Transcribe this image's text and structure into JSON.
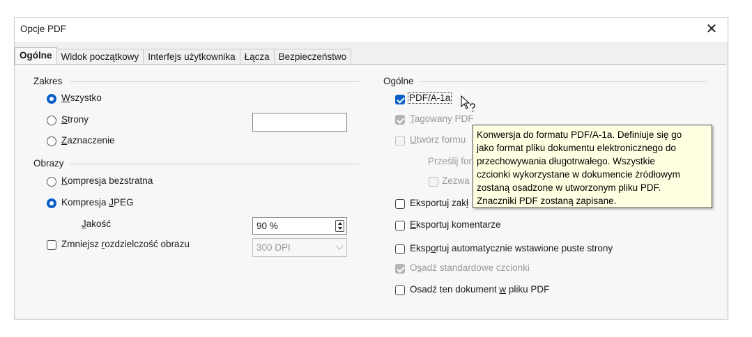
{
  "window": {
    "title": "Opcje PDF"
  },
  "tabs": [
    {
      "label": "Ogólne",
      "active": true
    },
    {
      "label": "Widok początkowy",
      "active": false
    },
    {
      "label": "Interfejs użytkownika",
      "active": false
    },
    {
      "label": "Łącza",
      "active": false
    },
    {
      "label": "Bezpieczeństwo",
      "active": false
    }
  ],
  "range": {
    "heading": "Zakres",
    "all": {
      "pre": "",
      "u": "W",
      "post": "szystko",
      "selected": true
    },
    "pages": {
      "pre": "",
      "u": "S",
      "post": "trony",
      "selected": false
    },
    "pages_value": "",
    "selection": {
      "pre": "",
      "u": "Z",
      "post": "aznaczenie",
      "selected": false
    }
  },
  "images": {
    "heading": "Obrazy",
    "lossless": {
      "pre": "",
      "u": "K",
      "post": "ompresja bezstratna",
      "selected": false
    },
    "jpeg": {
      "pre": "Kompresja ",
      "u": "J",
      "post": "PEG",
      "selected": true
    },
    "quality": {
      "pre": "",
      "u": "J",
      "post": "akość",
      "value": "90 %"
    },
    "reduce": {
      "pre": "Zmniejsz ",
      "u": "r",
      "post": "ozdzielczość obrazu",
      "checked": false,
      "value": "300 DPI"
    }
  },
  "general": {
    "heading": "Ogólne",
    "pdfa": {
      "label": "PDF/A-1a",
      "checked": true
    },
    "tagged": {
      "pre": "",
      "u": "T",
      "post": "agowany PDF",
      "checked": true,
      "disabled": true
    },
    "form": {
      "pre": "",
      "u": "U",
      "post": "twórz formu",
      "checked": false,
      "disabled": true
    },
    "submit": {
      "label": "Prześlij for"
    },
    "allow": {
      "label": "Zezwa",
      "checked": false
    },
    "bookmarks": {
      "pre": "Eksportuj zak",
      "u": "ł",
      "post": "",
      "checked": false
    },
    "comments": {
      "pre": "",
      "u": "E",
      "post": "ksportuj komentarze",
      "checked": false
    },
    "blank": {
      "pre": "Eksp",
      "u": "o",
      "post": "rtuj automatycznie wstawione puste strony",
      "checked": false
    },
    "fonts": {
      "pre": "O",
      "u": "s",
      "post": "adź standardowe czcionki",
      "checked": true,
      "disabled": true
    },
    "embed": {
      "pre": "Osadź ten dokument ",
      "u": "w",
      "post": " pliku PDF",
      "checked": false
    }
  },
  "tooltip": {
    "lines": [
      "Konwersja do formatu PDF/A-1a. Definiuje się go",
      "jako format pliku dokumentu elektronicznego do",
      "przechowywania długotrwałego. Wszystkie",
      "czcionki wykorzystane w dokumencie źródłowym",
      "zostaną osadzone w utworzonym pliku PDF.",
      "Znaczniki PDF zostaną zapisane."
    ]
  },
  "colors": {
    "accent": "#0a5fc7",
    "tooltip_bg": "#ffffe1"
  }
}
